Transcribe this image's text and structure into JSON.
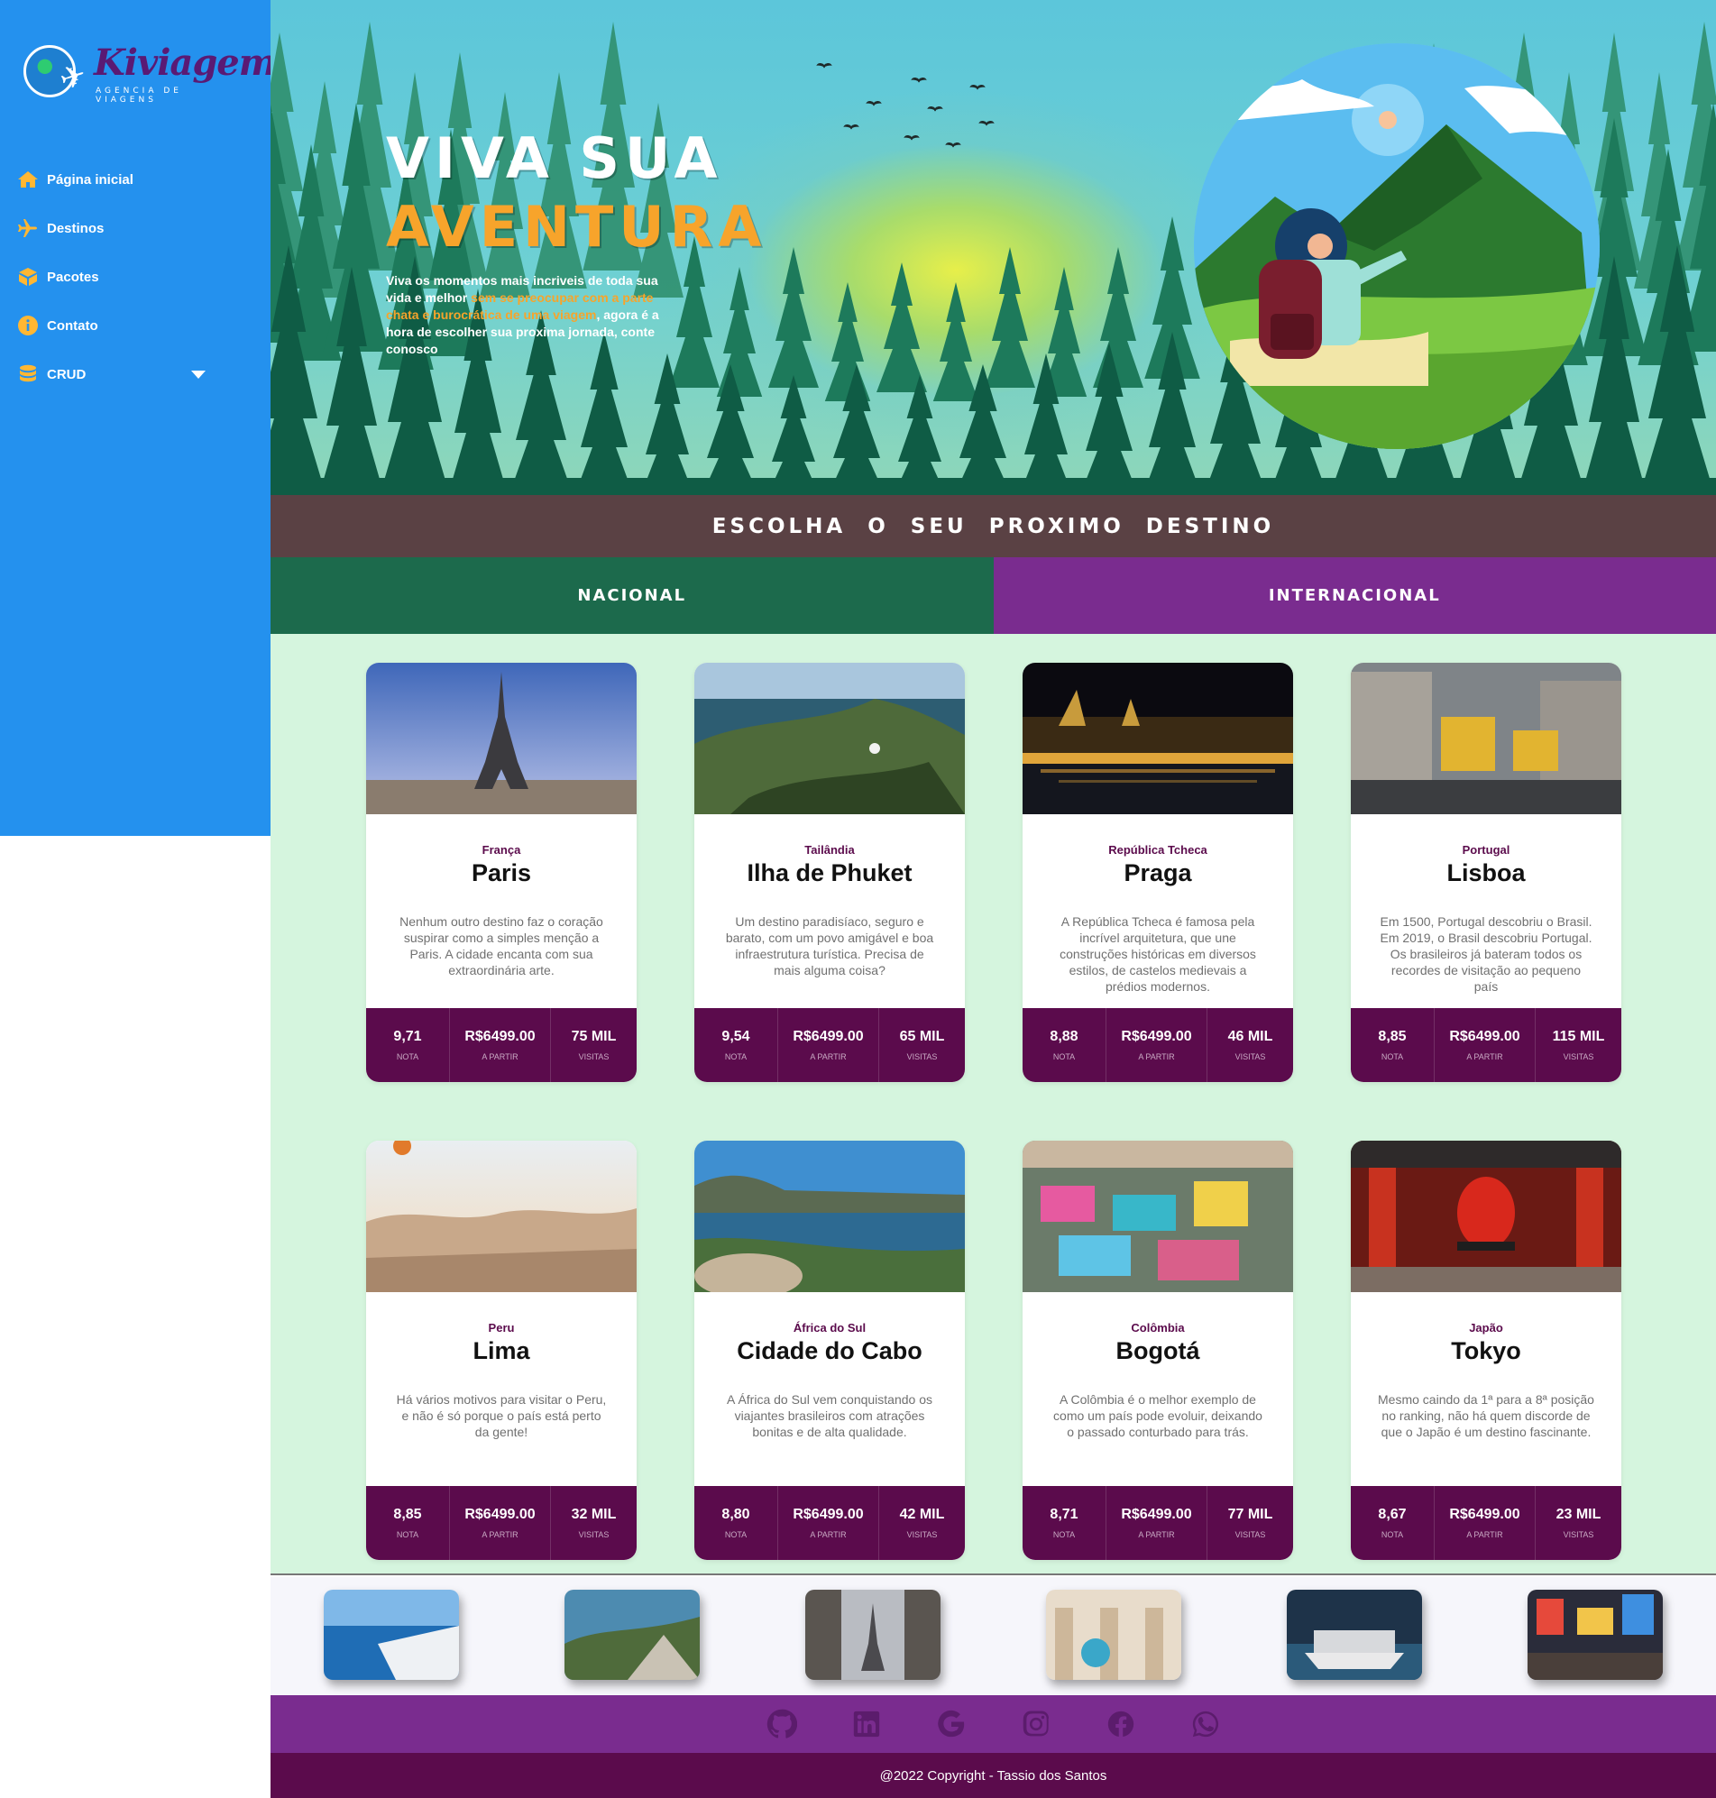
{
  "brand": {
    "name": "Kiviagem",
    "subtitle": "AGENCIA DE VIAGENS"
  },
  "sidebar": {
    "items": [
      {
        "label": "Página inicial",
        "icon": "home-icon"
      },
      {
        "label": "Destinos",
        "icon": "plane-icon"
      },
      {
        "label": "Pacotes",
        "icon": "box-icon"
      },
      {
        "label": "Contato",
        "icon": "info-icon"
      },
      {
        "label": "CRUD",
        "icon": "database-icon",
        "expandable": true
      }
    ]
  },
  "hero": {
    "title_line1": "VIVA SUA",
    "title_line2": "AVENTURA",
    "text_before": "Viva os momentos mais incriveis de toda sua vida e melhor ",
    "text_highlight": "sem se preocupar com a parte chata e burocrática de uma viagem",
    "text_after": ", agora é a hora de escolher sua proxima jornada, conte conosco"
  },
  "choose_title": "ESCOLHA O SEU PROXIMO DESTINO",
  "tabs": {
    "nacional": "NACIONAL",
    "internacional": "INTERNACIONAL"
  },
  "stat_labels": {
    "nota": "NOTA",
    "partir": "A PARTIR",
    "visitas": "VISITAS"
  },
  "cards": [
    {
      "country": "França",
      "city": "Paris",
      "description": "Nenhum outro destino faz o coração suspirar como a simples menção a Paris. A cidade encanta com sua extraordinária arte.",
      "nota": "9,71",
      "price": "R$6499.00",
      "visits": "75 MIL"
    },
    {
      "country": "Tailândia",
      "city": "Ilha de Phuket",
      "description": "Um destino paradisíaco, seguro e barato, com um povo amigável e boa infraestrutura turística. Precisa de mais alguma coisa?",
      "nota": "9,54",
      "price": "R$6499.00",
      "visits": "65 MIL"
    },
    {
      "country": "República Tcheca",
      "city": "Praga",
      "description": "A República Tcheca é famosa pela incrível arquitetura, que une construções históricas em diversos estilos, de castelos medievais a prédios modernos.",
      "nota": "8,88",
      "price": "R$6499.00",
      "visits": "46 MIL"
    },
    {
      "country": "Portugal",
      "city": "Lisboa",
      "description": "Em 1500, Portugal descobriu o Brasil. Em 2019, o Brasil descobriu Portugal. Os brasileiros já bateram todos os recordes de visitação ao pequeno país",
      "nota": "8,85",
      "price": "R$6499.00",
      "visits": "115 MIL"
    },
    {
      "country": "Peru",
      "city": "Lima",
      "description": "Há vários motivos para visitar o Peru, e não é só porque o país está perto da gente!",
      "nota": "8,85",
      "price": "R$6499.00",
      "visits": "32 MIL"
    },
    {
      "country": "África do Sul",
      "city": "Cidade do Cabo",
      "description": "A África do Sul vem conquistando os viajantes brasileiros com atrações bonitas e de alta qualidade.",
      "nota": "8,80",
      "price": "R$6499.00",
      "visits": "42 MIL"
    },
    {
      "country": "Colômbia",
      "city": "Bogotá",
      "description": "A Colômbia é o melhor exemplo de como um país pode evoluir, deixando o passado conturbado para trás.",
      "nota": "8,71",
      "price": "R$6499.00",
      "visits": "77 MIL"
    },
    {
      "country": "Japão",
      "city": "Tokyo",
      "description": "Mesmo caindo da 1ª para a 8ª posição no ranking, não há quem discorde de que o Japão é um destino fascinante.",
      "nota": "8,67",
      "price": "R$6499.00",
      "visits": "23 MIL"
    }
  ],
  "social_icons": [
    "github-icon",
    "linkedin-icon",
    "google-icon",
    "instagram-icon",
    "facebook-icon",
    "whatsapp-icon"
  ],
  "copyright": "@2022 Copyright - Tassio dos Santos",
  "colors": {
    "sidebar": "#2491ee",
    "accent": "#f7a42b",
    "card_stats": "#5b0b4c",
    "tab_nacional": "#1c6a4c",
    "tab_internacional": "#7a2c8f",
    "cards_bg": "#d5f5de"
  }
}
